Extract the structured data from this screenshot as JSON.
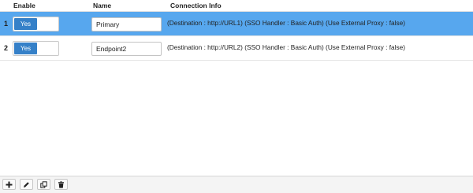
{
  "table": {
    "columns": {
      "enable": "Enable",
      "name": "Name",
      "connection_info": "Connection Info"
    },
    "rows": [
      {
        "index": "1",
        "enabled_label": "Yes",
        "name": "Primary",
        "connection_info": "(Destination : http://URL1) (SSO Handler : Basic Auth) (Use External Proxy : false)",
        "selected": true
      },
      {
        "index": "2",
        "enabled_label": "Yes",
        "name": "Endpoint2",
        "connection_info": "(Destination : http://URL2) (SSO Handler : Basic Auth) (Use External Proxy : false)",
        "selected": false
      }
    ]
  },
  "toolbar": {
    "buttons": [
      {
        "icon": "plus-icon"
      },
      {
        "icon": "pencil-icon"
      },
      {
        "icon": "copy-icon"
      },
      {
        "icon": "trash-icon"
      }
    ]
  },
  "colors": {
    "selected_row": "#57a7ee",
    "toggle_on": "#3580c8"
  }
}
